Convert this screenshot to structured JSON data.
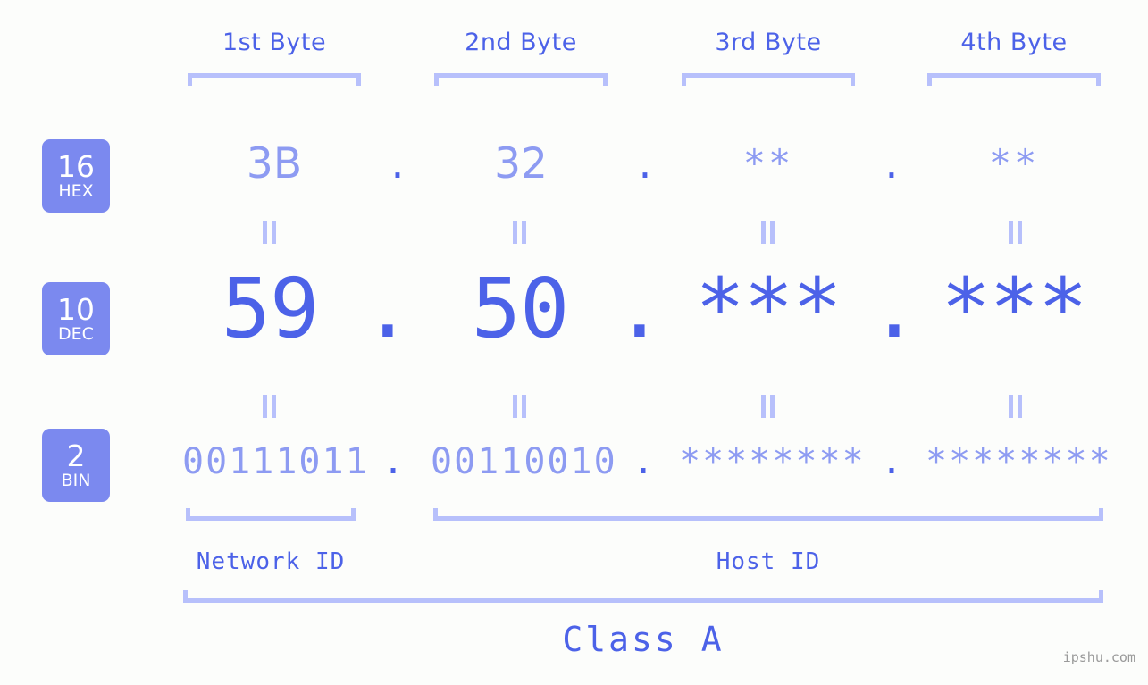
{
  "page": {
    "background_color": "#fcfdfb",
    "accent_color": "#4c62e8",
    "muted_accent_color": "#8d9bf2",
    "light_accent_color": "#b7c0fb",
    "badge_color": "#7b89ef",
    "watermark": "ipshu.com"
  },
  "byte_headers": [
    {
      "label": "1st Byte"
    },
    {
      "label": "2nd Byte"
    },
    {
      "label": "3rd Byte"
    },
    {
      "label": "4th Byte"
    }
  ],
  "bases": [
    {
      "number": "16",
      "name": "HEX"
    },
    {
      "number": "10",
      "name": "DEC"
    },
    {
      "number": "2",
      "name": "BIN"
    }
  ],
  "rows": {
    "hex": {
      "values": [
        "3B",
        "32",
        "**",
        "**"
      ],
      "separators": [
        ".",
        ".",
        "."
      ]
    },
    "dec": {
      "values": [
        "59",
        "50",
        "***",
        "***"
      ],
      "separators": [
        ".",
        ".",
        "."
      ]
    },
    "bin": {
      "values": [
        "00111011",
        "00110010",
        "********",
        "********"
      ],
      "separators": [
        ".",
        ".",
        "."
      ]
    }
  },
  "equals_symbol": "=",
  "segments": {
    "network_id": "Network ID",
    "host_id": "Host ID",
    "class": "Class A"
  }
}
